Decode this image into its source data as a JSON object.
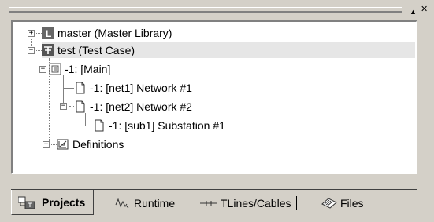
{
  "window": {
    "pin_label": "▲",
    "close_label": "✕"
  },
  "tree": {
    "nodes": [
      {
        "label": "master (Master Library)"
      },
      {
        "label": "test (Test Case)"
      },
      {
        "label": "-1: [Main]"
      },
      {
        "label": "-1: [net1] Network #1"
      },
      {
        "label": "-1: [net2] Network #2"
      },
      {
        "label": "-1: [sub1] Substation #1"
      },
      {
        "label": "Definitions"
      }
    ],
    "expanders": [
      "+",
      "−",
      "−",
      "−",
      "+"
    ]
  },
  "tabs": [
    {
      "label": "Projects",
      "active": true
    },
    {
      "label": "Runtime"
    },
    {
      "label": "TLines/Cables"
    },
    {
      "label": "Files"
    }
  ]
}
